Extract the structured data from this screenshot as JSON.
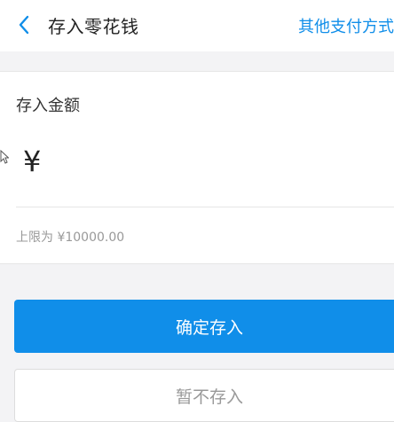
{
  "header": {
    "back_icon": "chevron-left-icon",
    "title": "存入零花钱",
    "other_payment_label": "其他支付方式"
  },
  "amount_card": {
    "label": "存入金额",
    "currency_symbol": "¥",
    "input_value": "",
    "limit_text": "上限为 ¥10000.00"
  },
  "buttons": {
    "confirm_label": "确定存入",
    "skip_label": "暂不存入"
  },
  "colors": {
    "accent": "#108ee9",
    "background": "#f3f3f5"
  }
}
